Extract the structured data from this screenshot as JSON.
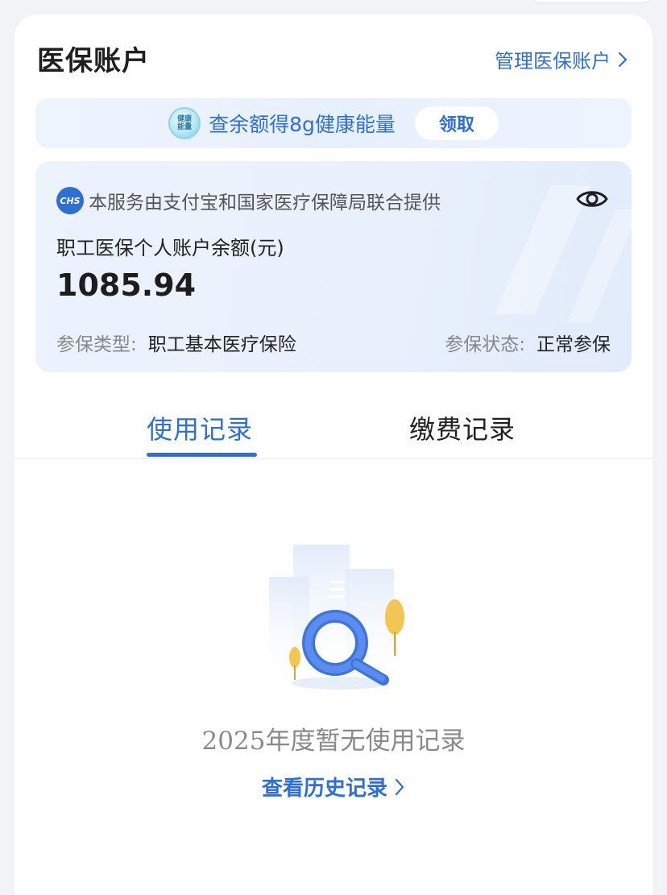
{
  "header": {
    "title": "医保账户",
    "manage_label": "管理医保账户"
  },
  "promo": {
    "badge_line1": "健康",
    "badge_line2": "能量",
    "text": "查余额得8g健康能量",
    "button_label": "领取"
  },
  "account": {
    "logo_text": "CHS",
    "provider_text": "本服务由支付宝和国家医疗保障局联合提供",
    "balance_label": "职工医保个人账户余额(元)",
    "balance_value": "1085.94",
    "insurance_type_label": "参保类型:",
    "insurance_type_value": "职工基本医疗保险",
    "insurance_status_label": "参保状态:",
    "insurance_status_value": "正常参保"
  },
  "tabs": [
    {
      "label": "使用记录",
      "active": true
    },
    {
      "label": "缴费记录",
      "active": false
    }
  ],
  "empty_state": {
    "message": "2025年度暂无使用记录",
    "history_link": "查看历史记录"
  },
  "colors": {
    "accent": "#2f6fd1",
    "tree": "#f3c653"
  },
  "icons": [
    "chevron-right-icon",
    "health-energy-badge-icon",
    "chs-logo-icon",
    "eye-icon",
    "search-illustration-icon"
  ]
}
